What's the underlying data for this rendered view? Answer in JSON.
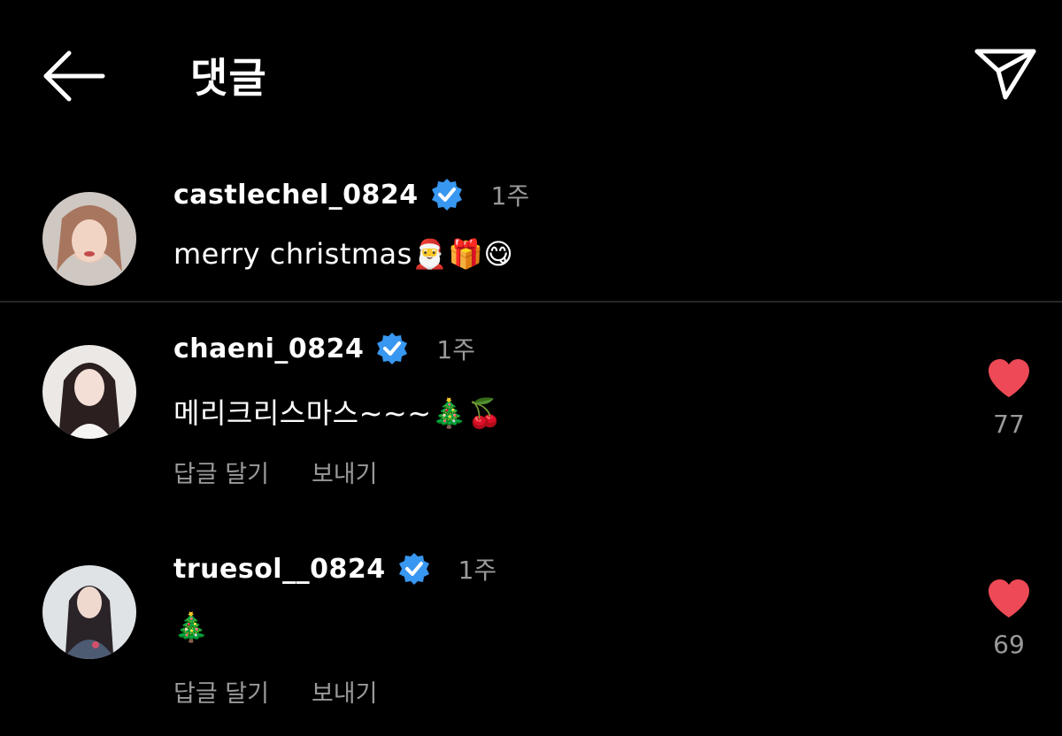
{
  "header": {
    "title": "댓글",
    "back_icon": "arrow-left-icon",
    "share_icon": "paper-plane-icon"
  },
  "comments": [
    {
      "username": "castlechel_0824",
      "verified": true,
      "time": "1주",
      "text": "merry christmas🎅🎁😋",
      "avatar_colors": [
        "#d9b6a8",
        "#8a5a4a"
      ]
    },
    {
      "username": "chaeni_0824",
      "verified": true,
      "time": "1주",
      "text": "메리크리스마스~~~🎄🍒",
      "reply_label": "답글 달기",
      "send_label": "보내기",
      "likes": "77",
      "avatar_colors": [
        "#e8e4e2",
        "#2a2020"
      ]
    },
    {
      "username": "truesol__0824",
      "verified": true,
      "time": "1주",
      "text": "🎄",
      "reply_label": "답글 달기",
      "send_label": "보내기",
      "likes": "69",
      "avatar_colors": [
        "#d8dde2",
        "#3a3a48"
      ]
    }
  ],
  "colors": {
    "background": "#000000",
    "verified_blue": "#3897f0",
    "heart_red": "#ed4956",
    "secondary_text": "#9a9a9a",
    "divider": "#262626"
  }
}
